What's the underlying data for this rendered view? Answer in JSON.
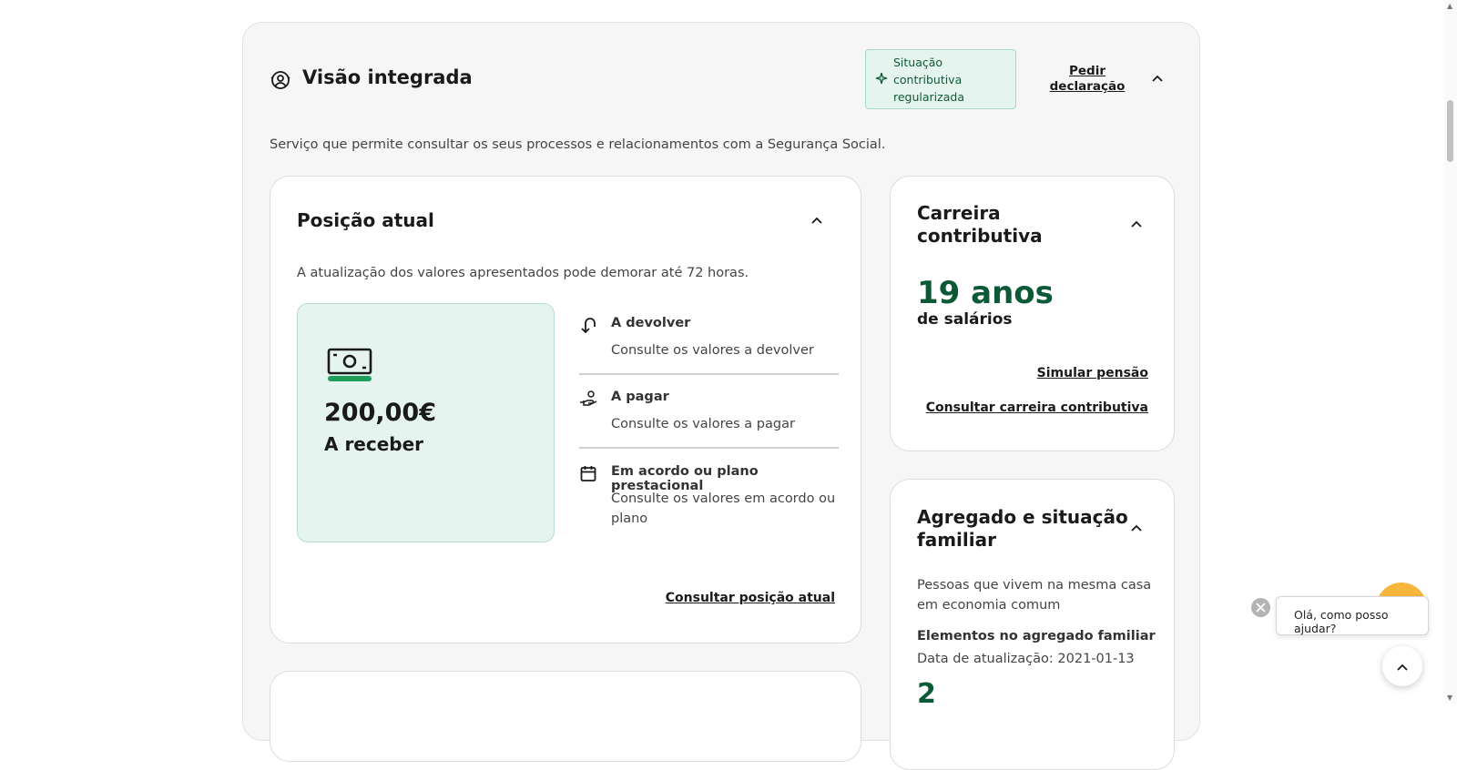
{
  "panel": {
    "title": "Visão integrada",
    "status_badge": "Situação contributiva regularizada",
    "request_declaration": "Pedir declaração",
    "description": "Serviço que permite consultar os seus processos e relacionamentos com a Segurança Social."
  },
  "current_position": {
    "title": "Posição atual",
    "note": "A atualização dos valores apresentados pode demorar até 72 horas.",
    "amount": "200,00€",
    "amount_label": "A receber",
    "items": [
      {
        "title": "A devolver",
        "desc": "Consulte os valores a devolver",
        "icon": "return-arrow-icon"
      },
      {
        "title": "A pagar",
        "desc": "Consulte os valores a pagar",
        "icon": "hand-coin-icon"
      },
      {
        "title": "Em acordo ou plano prestacional",
        "desc": "Consulte os valores em acordo ou plano",
        "icon": "calendar-icon"
      }
    ],
    "link": "Consultar posição atual"
  },
  "career": {
    "title": "Carreira contributiva",
    "years": "19 anos",
    "years_sub": "de salários",
    "simulate_link": "Simular pensão",
    "consult_link": "Consultar carreira contributiva"
  },
  "household": {
    "title": "Agregado e situação familiar",
    "desc": "Pessoas que vivem na mesma casa em economia comum",
    "elements_label": "Elementos no agregado familiar",
    "update_date": "Data de atualização: 2021-01-13",
    "count": "2"
  },
  "chat": {
    "greeting": "Olá, como posso ajudar?"
  },
  "colors": {
    "brand_green": "#0b5a35",
    "badge_bg": "#e5f4ee",
    "chat_orange": "#f6b73c"
  }
}
